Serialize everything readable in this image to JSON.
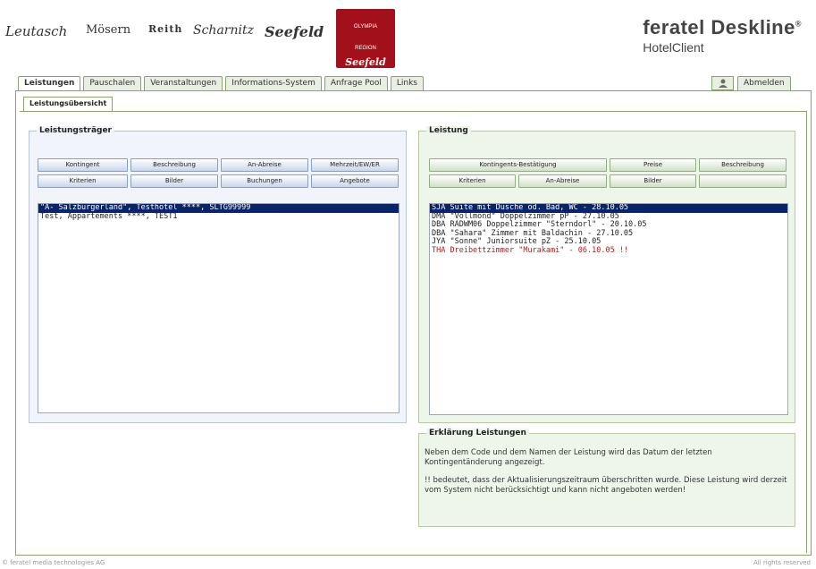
{
  "header": {
    "logos": [
      "Leutasch",
      "Mösern",
      "Reith",
      "Scharnitz",
      "Seefeld"
    ],
    "badge_line1": "OLYMPIA",
    "badge_line2": "REGION",
    "badge_line3": "Seefeld",
    "brand_title": "feratel Deskline",
    "brand_mark": "®",
    "brand_sub": "HotelClient"
  },
  "tabs": [
    "Leistungen",
    "Pauschalen",
    "Veranstaltungen",
    "Informations-System",
    "Anfrage Pool",
    "Links"
  ],
  "logout_label": "Abmelden",
  "subtab": "Leistungsübersicht",
  "left_panel": {
    "title": "Leistungsträger",
    "buttons_row1": [
      "Kontingent",
      "Beschreibung",
      "An-Abreise",
      "Mehrzeit/EW/ER"
    ],
    "buttons_row2": [
      "Kriterien",
      "Bilder",
      "Buchungen",
      "Angebote"
    ],
    "items": [
      "\"A- Salzburgerland\", Testhotel ****, SLTG99999",
      "Test, Appartements ****, TEST1"
    ]
  },
  "right_panel": {
    "title": "Leistung",
    "buttons_row1": [
      "Kontingents-Bestätigung",
      "Preise",
      "Beschreibung"
    ],
    "buttons_row2": [
      "Kriterien",
      "An-Abreise",
      "Bilder",
      ""
    ],
    "items": [
      "SJA  Suite mit Dusche od. Bad, WC - 28.10.05",
      "DMA  \"Vollmond\" Doppelzimmer pP - 27.10.05",
      "DBA  RADWM06 Doppelzimmer \"Sterndorl\" - 20.10.05",
      "DBA  \"Sahara\" Zimmer mit Baldachin - 27.10.05",
      "JYA  \"Sonne\" Juniorsuite pZ - 25.10.05",
      "THA  Dreibettzimmer \"Murakami\" - 06.10.05 !!"
    ]
  },
  "info_panel": {
    "title": "Erklärung Leistungen",
    "p1": "Neben dem Code und dem Namen der Leistung wird das Datum der letzten Kontingentänderung angezeigt.",
    "p2": "!! bedeutet, dass der Aktualisierungszeitraum überschritten wurde. Diese Leistung wird derzeit vom System nicht berücksichtigt und kann nicht angeboten werden!"
  },
  "footer": {
    "left": "© feratel media technologies AG",
    "right": "All rights reserved"
  }
}
